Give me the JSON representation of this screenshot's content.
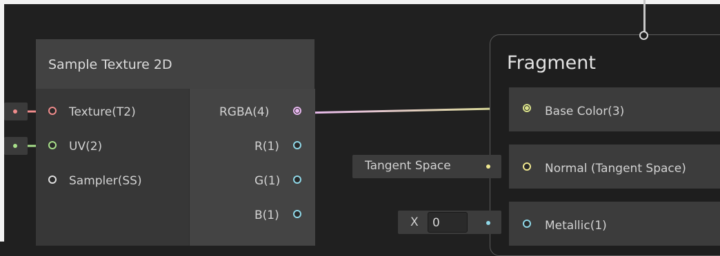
{
  "node": {
    "title": "Sample Texture 2D",
    "inputs": [
      {
        "label": "Texture(T2)",
        "color": "#f08c8c"
      },
      {
        "label": "UV(2)",
        "color": "#a8e08a"
      },
      {
        "label": "Sampler(SS)",
        "color": "#e0e0e0"
      }
    ],
    "outputs": [
      {
        "label": "RGBA(4)",
        "color": "#e8b8f0"
      },
      {
        "label": "R(1)",
        "color": "#8fd8e8"
      },
      {
        "label": "G(1)",
        "color": "#8fd8e8"
      },
      {
        "label": "B(1)",
        "color": "#8fd8e8"
      }
    ]
  },
  "fragment": {
    "title": "Fragment",
    "ports": [
      {
        "label": "Base Color(3)",
        "color": "#d8e08a"
      },
      {
        "label": "Normal (Tangent Space)",
        "color": "#f0e890"
      },
      {
        "label": "Metallic(1)",
        "color": "#8fd8e8"
      }
    ]
  },
  "inline_inputs": {
    "tangent_space_label": "Tangent Space",
    "metallic_axis": "X",
    "metallic_value": "0"
  }
}
